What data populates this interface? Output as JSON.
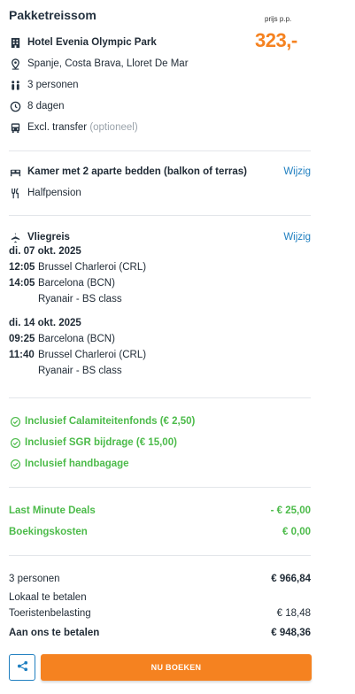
{
  "header": {
    "title": "Pakketreissom",
    "price_label": "prijs p.p.",
    "price": "323,-"
  },
  "info": {
    "hotel": "Hotel Evenia Olympic Park",
    "location": "Spanje, Costa Brava, Lloret De Mar",
    "persons": "3 personen",
    "duration": "8 dagen",
    "transfer": "Excl. transfer",
    "transfer_note": "(optioneel)"
  },
  "room": {
    "label": "Kamer met 2 aparte bedden (balkon of terras)",
    "board": "Halfpension",
    "edit": "Wijzig"
  },
  "flight": {
    "title": "Vliegreis",
    "edit": "Wijzig",
    "outbound": {
      "date": "di. 07 okt. 2025",
      "dep_time": "12:05",
      "dep_airport": "Brussel Charleroi (CRL)",
      "arr_time": "14:05",
      "arr_airport": "Barcelona (BCN)",
      "carrier": "Ryanair - BS class"
    },
    "return": {
      "date": "di. 14 okt. 2025",
      "dep_time": "09:25",
      "dep_airport": "Barcelona (BCN)",
      "arr_time": "11:40",
      "arr_airport": "Brussel Charleroi (CRL)",
      "carrier": "Ryanair - BS class"
    }
  },
  "inclusions": [
    "Inclusief Calamiteitenfonds (€ 2,50)",
    "Inclusief SGR bijdrage (€ 15,00)",
    "Inclusief handbagage"
  ],
  "discounts": [
    {
      "label": "Last Minute Deals",
      "value": "- € 25,00"
    },
    {
      "label": "Boekingskosten",
      "value": "€ 0,00"
    }
  ],
  "totals": {
    "persons_label": "3 personen",
    "persons_value": "€ 966,84",
    "local_label": "Lokaal te betalen",
    "tax_label": "Toeristenbelasting",
    "tax_value": "€ 18,48",
    "pay_label": "Aan ons te betalen",
    "pay_value": "€ 948,36"
  },
  "actions": {
    "book": "NU BOEKEN"
  },
  "colors": {
    "accent": "#f58220",
    "link": "#1f7fc0",
    "green": "#4cbb4a"
  }
}
